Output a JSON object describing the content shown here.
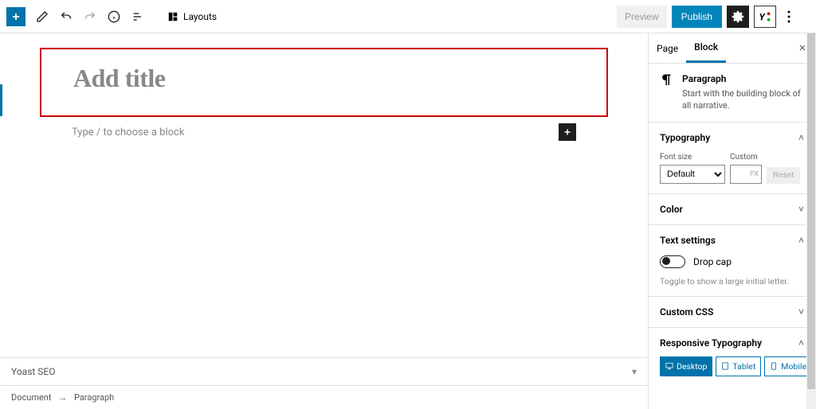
{
  "toolbar": {
    "layouts_label": "Layouts",
    "preview_label": "Preview",
    "publish_label": "Publish"
  },
  "editor": {
    "title_placeholder": "Add title",
    "block_placeholder": "Type / to choose a block"
  },
  "yoast_panel_label": "Yoast SEO",
  "breadcrumb": {
    "document": "Document",
    "arrow": "→",
    "current": "Paragraph"
  },
  "sidebar": {
    "tab_page": "Page",
    "tab_block": "Block",
    "block_info": {
      "title": "Paragraph",
      "desc": "Start with the building block of all narrative."
    },
    "typography": {
      "title": "Typography",
      "font_size_label": "Font size",
      "custom_label": "Custom",
      "custom_unit": "PX",
      "default_option": "Default",
      "reset_label": "Reset"
    },
    "color": {
      "title": "Color"
    },
    "text_settings": {
      "title": "Text settings",
      "drop_cap_label": "Drop cap",
      "drop_cap_help": "Toggle to show a large initial letter."
    },
    "custom_css": {
      "title": "Custom CSS"
    },
    "responsive": {
      "title": "Responsive Typography",
      "desktop": "Desktop",
      "tablet": "Tablet",
      "mobile": "Mobile"
    }
  }
}
